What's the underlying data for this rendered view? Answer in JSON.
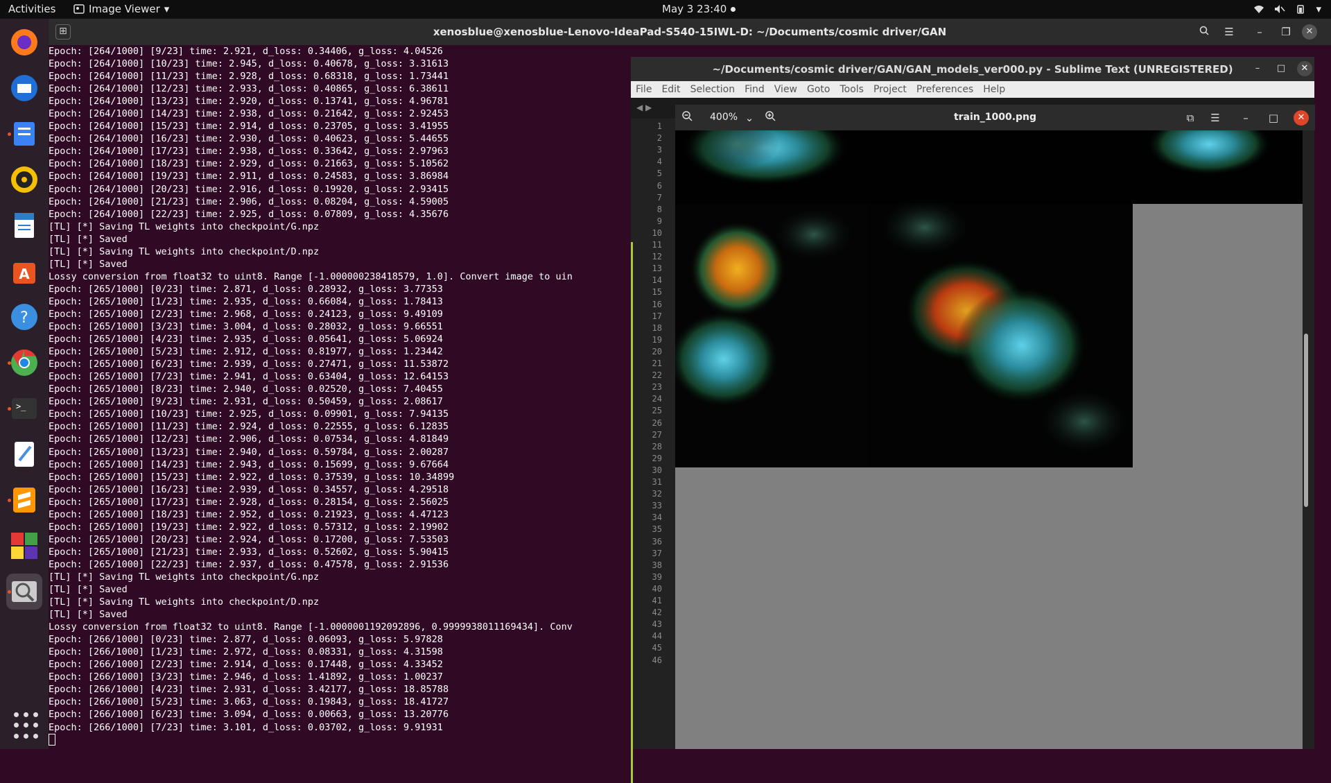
{
  "topbar": {
    "activities": "Activities",
    "app_name": "Image Viewer",
    "clock": "May 3  23:40"
  },
  "dock": {
    "items": [
      {
        "name": "Firefox",
        "color": "#ff7a1a"
      },
      {
        "name": "Thunderbird",
        "color": "#1f6fd6"
      },
      {
        "name": "Files",
        "color": "#3b82f6"
      },
      {
        "name": "Rhythmbox",
        "color": "#f5c000"
      },
      {
        "name": "LibreOffice Writer",
        "color": "#2f7dc9"
      },
      {
        "name": "Ubuntu Software",
        "color": "#e95420"
      },
      {
        "name": "Help",
        "color": "#3a8fe0"
      },
      {
        "name": "Chrome",
        "color": "#4caf50"
      },
      {
        "name": "Terminal",
        "color": "#333333"
      },
      {
        "name": "Text Editor",
        "color": "#4a90e2"
      },
      {
        "name": "Sublime Text",
        "color": "#ff9800"
      },
      {
        "name": "App Grid",
        "color": "#8e44ad"
      },
      {
        "name": "Image Viewer",
        "color": "#cccccc"
      }
    ]
  },
  "terminal": {
    "title": "xenosblue@xenosblue-Lenovo-IdeaPad-S540-15IWL-D: ~/Documents/cosmic driver/GAN",
    "lines": [
      "Epoch: [264/1000] [9/23] time: 2.921, d_loss: 0.34406, g_loss: 4.04526",
      "Epoch: [264/1000] [10/23] time: 2.945, d_loss: 0.40678, g_loss: 3.31613",
      "Epoch: [264/1000] [11/23] time: 2.928, d_loss: 0.68318, g_loss: 1.73441",
      "Epoch: [264/1000] [12/23] time: 2.933, d_loss: 0.40865, g_loss: 6.38611",
      "Epoch: [264/1000] [13/23] time: 2.920, d_loss: 0.13741, g_loss: 4.96781",
      "Epoch: [264/1000] [14/23] time: 2.938, d_loss: 0.21642, g_loss: 2.92453",
      "Epoch: [264/1000] [15/23] time: 2.914, d_loss: 0.23705, g_loss: 3.41955",
      "Epoch: [264/1000] [16/23] time: 2.930, d_loss: 0.40623, g_loss: 5.44655",
      "Epoch: [264/1000] [17/23] time: 2.938, d_loss: 0.33642, g_loss: 2.97963",
      "Epoch: [264/1000] [18/23] time: 2.929, d_loss: 0.21663, g_loss: 5.10562",
      "Epoch: [264/1000] [19/23] time: 2.911, d_loss: 0.24583, g_loss: 3.86984",
      "Epoch: [264/1000] [20/23] time: 2.916, d_loss: 0.19920, g_loss: 2.93415",
      "Epoch: [264/1000] [21/23] time: 2.906, d_loss: 0.08204, g_loss: 4.59005",
      "Epoch: [264/1000] [22/23] time: 2.925, d_loss: 0.07809, g_loss: 4.35676",
      "[TL] [*] Saving TL weights into checkpoint/G.npz",
      "[TL] [*] Saved",
      "[TL] [*] Saving TL weights into checkpoint/D.npz",
      "[TL] [*] Saved",
      "Lossy conversion from float32 to uint8. Range [-1.000000238418579, 1.0]. Convert image to uin",
      "Epoch: [265/1000] [0/23] time: 2.871, d_loss: 0.28932, g_loss: 3.77353",
      "Epoch: [265/1000] [1/23] time: 2.935, d_loss: 0.66084, g_loss: 1.78413",
      "Epoch: [265/1000] [2/23] time: 2.968, d_loss: 0.24123, g_loss: 9.49109",
      "Epoch: [265/1000] [3/23] time: 3.004, d_loss: 0.28032, g_loss: 9.66551",
      "Epoch: [265/1000] [4/23] time: 2.935, d_loss: 0.05641, g_loss: 5.06924",
      "Epoch: [265/1000] [5/23] time: 2.912, d_loss: 0.81977, g_loss: 1.23442",
      "Epoch: [265/1000] [6/23] time: 2.939, d_loss: 0.27471, g_loss: 11.53872",
      "Epoch: [265/1000] [7/23] time: 2.941, d_loss: 0.63404, g_loss: 12.64153",
      "Epoch: [265/1000] [8/23] time: 2.940, d_loss: 0.02520, g_loss: 7.40455",
      "Epoch: [265/1000] [9/23] time: 2.931, d_loss: 0.50459, g_loss: 2.08617",
      "Epoch: [265/1000] [10/23] time: 2.925, d_loss: 0.09901, g_loss: 7.94135",
      "Epoch: [265/1000] [11/23] time: 2.924, d_loss: 0.22555, g_loss: 6.12835",
      "Epoch: [265/1000] [12/23] time: 2.906, d_loss: 0.07534, g_loss: 4.81849",
      "Epoch: [265/1000] [13/23] time: 2.940, d_loss: 0.59784, g_loss: 2.00287",
      "Epoch: [265/1000] [14/23] time: 2.943, d_loss: 0.15699, g_loss: 9.67664",
      "Epoch: [265/1000] [15/23] time: 2.922, d_loss: 0.37539, g_loss: 10.34899",
      "Epoch: [265/1000] [16/23] time: 2.939, d_loss: 0.34557, g_loss: 4.29518",
      "Epoch: [265/1000] [17/23] time: 2.928, d_loss: 0.28154, g_loss: 2.56025",
      "Epoch: [265/1000] [18/23] time: 2.952, d_loss: 0.21923, g_loss: 4.47123",
      "Epoch: [265/1000] [19/23] time: 2.922, d_loss: 0.57312, g_loss: 2.19902",
      "Epoch: [265/1000] [20/23] time: 2.924, d_loss: 0.17200, g_loss: 7.53503",
      "Epoch: [265/1000] [21/23] time: 2.933, d_loss: 0.52602, g_loss: 5.90415",
      "Epoch: [265/1000] [22/23] time: 2.937, d_loss: 0.47578, g_loss: 2.91536",
      "[TL] [*] Saving TL weights into checkpoint/G.npz",
      "[TL] [*] Saved",
      "[TL] [*] Saving TL weights into checkpoint/D.npz",
      "[TL] [*] Saved",
      "Lossy conversion from float32 to uint8. Range [-1.0000001192092896, 0.9999938011169434]. Conv",
      "Epoch: [266/1000] [0/23] time: 2.877, d_loss: 0.06093, g_loss: 5.97828",
      "Epoch: [266/1000] [1/23] time: 2.972, d_loss: 0.08331, g_loss: 4.31598",
      "Epoch: [266/1000] [2/23] time: 2.914, d_loss: 0.17448, g_loss: 4.33452",
      "Epoch: [266/1000] [3/23] time: 2.946, d_loss: 1.41892, g_loss: 1.00237",
      "Epoch: [266/1000] [4/23] time: 2.931, d_loss: 3.42177, g_loss: 18.85788",
      "Epoch: [266/1000] [5/23] time: 3.063, d_loss: 0.19843, g_loss: 18.41727",
      "Epoch: [266/1000] [6/23] time: 3.094, d_loss: 0.00663, g_loss: 13.20776",
      "Epoch: [266/1000] [7/23] time: 3.101, d_loss: 0.03702, g_loss: 9.91931"
    ]
  },
  "sublime": {
    "title": "~/Documents/cosmic driver/GAN/GAN_models_ver000.py - Sublime Text (UNREGISTERED)",
    "menu": [
      "File",
      "Edit",
      "Selection",
      "Find",
      "View",
      "Goto",
      "Tools",
      "Project",
      "Preferences",
      "Help"
    ],
    "line_numbers": [
      "1",
      "2",
      "3",
      "4",
      "5",
      "6",
      "7",
      "8",
      "9",
      "10",
      "11",
      "12",
      "13",
      "14",
      "15",
      "16",
      "17",
      "18",
      "19",
      "20",
      "21",
      "22",
      "23",
      "24",
      "25",
      "26",
      "27",
      "28",
      "29",
      "30",
      "31",
      "32",
      "33",
      "34",
      "35",
      "36",
      "37",
      "38",
      "39",
      "40",
      "41",
      "42",
      "43",
      "44",
      "45",
      "46"
    ]
  },
  "image_viewer": {
    "zoom": "400%",
    "filename": "train_1000.png"
  }
}
